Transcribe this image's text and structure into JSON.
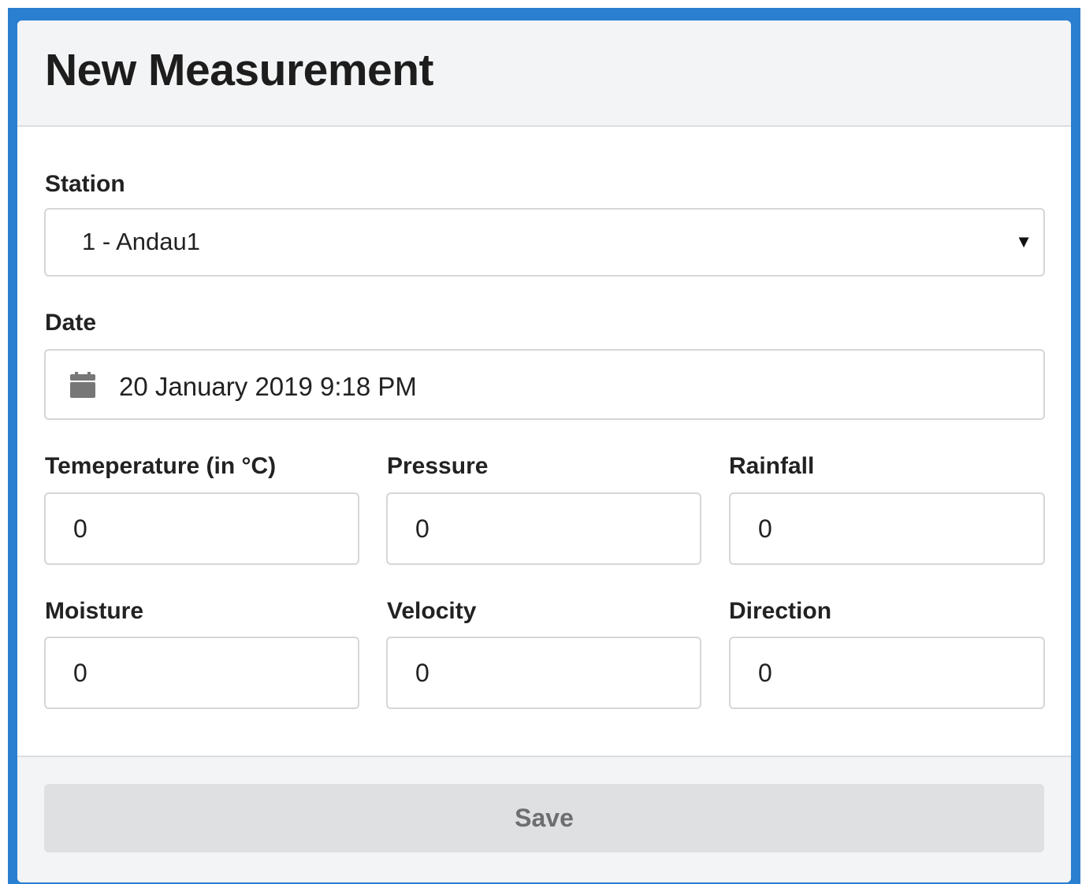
{
  "form": {
    "title": "New Measurement",
    "save_label": "Save"
  },
  "fields": {
    "station": {
      "label": "Station",
      "value": "1 - Andau1"
    },
    "date": {
      "label": "Date",
      "value": "20 January 2019 9:18 PM"
    },
    "temperature": {
      "label": "Temeperature (in °C)",
      "value": "0"
    },
    "pressure": {
      "label": "Pressure",
      "value": "0"
    },
    "rainfall": {
      "label": "Rainfall",
      "value": "0"
    },
    "moisture": {
      "label": "Moisture",
      "value": "0"
    },
    "velocity": {
      "label": "Velocity",
      "value": "0"
    },
    "direction": {
      "label": "Direction",
      "value": "0"
    }
  },
  "icons": {
    "station_dropdown": "caret-down-icon",
    "date": "calendar-icon"
  },
  "colors": {
    "frame_border": "#2a7fd0",
    "header_background": "#f3f4f5",
    "button_background": "#dfe0e1",
    "button_text": "#6d6e70"
  }
}
